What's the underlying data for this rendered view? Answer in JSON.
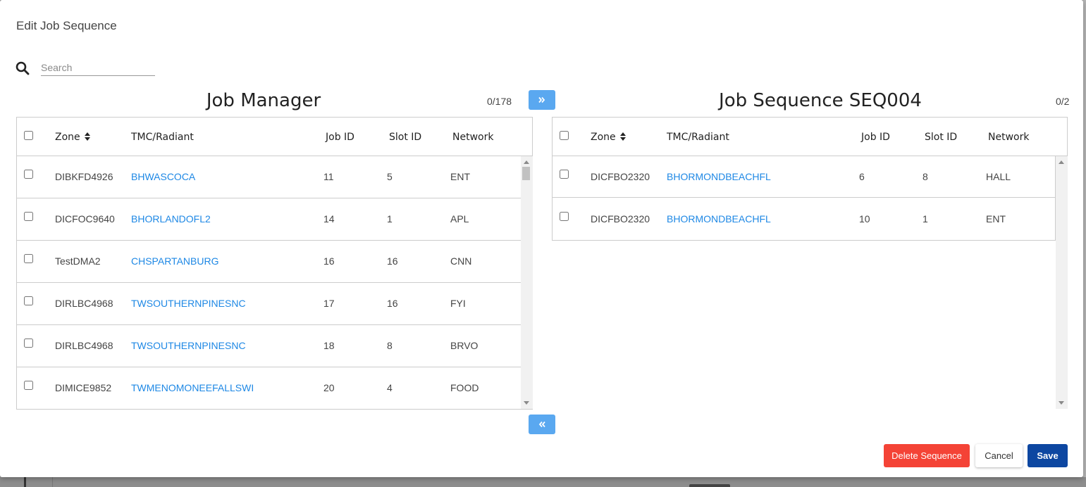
{
  "dialog": {
    "title": "Edit Job Sequence"
  },
  "search": {
    "placeholder": "Search",
    "value": ""
  },
  "left_panel": {
    "title": "Job Manager",
    "count": "0/178",
    "columns": {
      "zone": "Zone",
      "tmc": "TMC/Radiant",
      "job_id": "Job ID",
      "slot_id": "Slot ID",
      "network": "Network"
    },
    "rows": [
      {
        "zone": "DIBKFD4926",
        "tmc": "BHWASCOCA",
        "job_id": "11",
        "slot_id": "5",
        "network": "ENT"
      },
      {
        "zone": "DICFOC9640",
        "tmc": "BHORLANDOFL2",
        "job_id": "14",
        "slot_id": "1",
        "network": "APL"
      },
      {
        "zone": "TestDMA2",
        "tmc": "CHSPARTANBURG",
        "job_id": "16",
        "slot_id": "16",
        "network": "CNN"
      },
      {
        "zone": "DIRLBC4968",
        "tmc": "TWSOUTHERNPINESNC",
        "job_id": "17",
        "slot_id": "16",
        "network": "FYI"
      },
      {
        "zone": "DIRLBC4968",
        "tmc": "TWSOUTHERNPINESNC",
        "job_id": "18",
        "slot_id": "8",
        "network": "BRVO"
      },
      {
        "zone": "DIMICE9852",
        "tmc": "TWMENOMONEEFALLSWI",
        "job_id": "20",
        "slot_id": "4",
        "network": "FOOD"
      }
    ]
  },
  "right_panel": {
    "title": "Job Sequence SEQ004",
    "count": "0/2",
    "columns": {
      "zone": "Zone",
      "tmc": "TMC/Radiant",
      "job_id": "Job ID",
      "slot_id": "Slot ID",
      "network": "Network"
    },
    "rows": [
      {
        "zone": "DICFBO2320",
        "tmc": "BHORMONDBEACHFL",
        "job_id": "6",
        "slot_id": "8",
        "network": "HALL"
      },
      {
        "zone": "DICFBO2320",
        "tmc": "BHORMONDBEACHFL",
        "job_id": "10",
        "slot_id": "1",
        "network": "ENT"
      }
    ]
  },
  "move_buttons": {
    "right_icon": "double-chevron-right-icon",
    "left_icon": "double-chevron-left-icon"
  },
  "footer": {
    "delete_label": "Delete Sequence",
    "cancel_label": "Cancel",
    "save_label": "Save"
  },
  "colors": {
    "link": "#1e88e5",
    "move_button": "#5aa8f0",
    "delete": "#f44336",
    "save": "#0d47a1"
  }
}
